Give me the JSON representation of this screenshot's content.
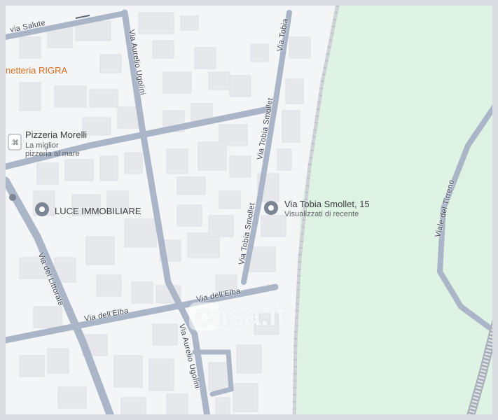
{
  "map": {
    "colors": {
      "background": "#f4f5f7",
      "park": "#dff3e4",
      "road": "#aab6c8",
      "building": "#e6e8ec",
      "pin": "#7b8593",
      "railway": "#c8cbd0"
    },
    "roads": {
      "via_salute": "via Salute",
      "via_aurelio_ugolini_top": "Via Aurelio Ugolini",
      "via_aurelio_ugolini_bottom": "Via Aurelio Ugolini",
      "via_tobia_top": "Via Tobia",
      "via_tobia_smollet_mid": "Via Tobia Smollet",
      "via_tobia_smollet_low": "Via Tobia Smollet",
      "via_del_littorale": "Via del Littorale",
      "via_dell_elba_left": "Via dell'Elba",
      "via_dell_elba_right": "Via dell'Elba",
      "viale_del_tirreno": "Viale del Tirreno"
    },
    "places": {
      "rigra": "netteria RIGRA",
      "pizzeria_title": "Pizzeria Morelli",
      "pizzeria_sub1": "La miglior",
      "pizzeria_sub2": "pizzeria al mare",
      "luce": "LUCE IMMOBILIARE",
      "address_title": "Via Tobia Smollet, 15",
      "address_sub": "Visualizzati di recente"
    },
    "icons": {
      "pizzeria": "restaurant-icon",
      "luce": "location-pin-icon",
      "address": "location-pin-icon"
    },
    "watermark": "casa.it"
  }
}
